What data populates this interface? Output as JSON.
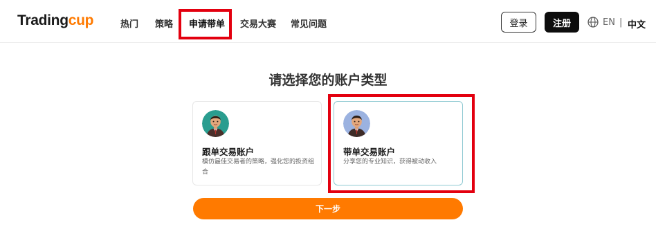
{
  "brand": {
    "logo_part1": "Trading",
    "logo_part2": "cup"
  },
  "nav": [
    {
      "label": "热门"
    },
    {
      "label": "策略"
    },
    {
      "label": "申请带单"
    },
    {
      "label": "交易大赛"
    },
    {
      "label": "常见问题"
    }
  ],
  "auth": {
    "login_label": "登录",
    "register_label": "注册"
  },
  "language": {
    "icon": "globe-icon",
    "en": "EN",
    "separator": "|",
    "zh": "中文"
  },
  "main": {
    "title": "请选择您的账户类型",
    "cards": [
      {
        "title": "跟单交易账户",
        "desc": "模仿最佳交易者的策略，强化您的投资组合"
      },
      {
        "title": "带单交易账户",
        "desc": "分享您的专业知识，获得被动收入"
      }
    ],
    "next_label": "下一步"
  },
  "colors": {
    "accent": "#ff7a00",
    "highlight": "#e3000f",
    "selected_border": "#8ec9d2"
  }
}
